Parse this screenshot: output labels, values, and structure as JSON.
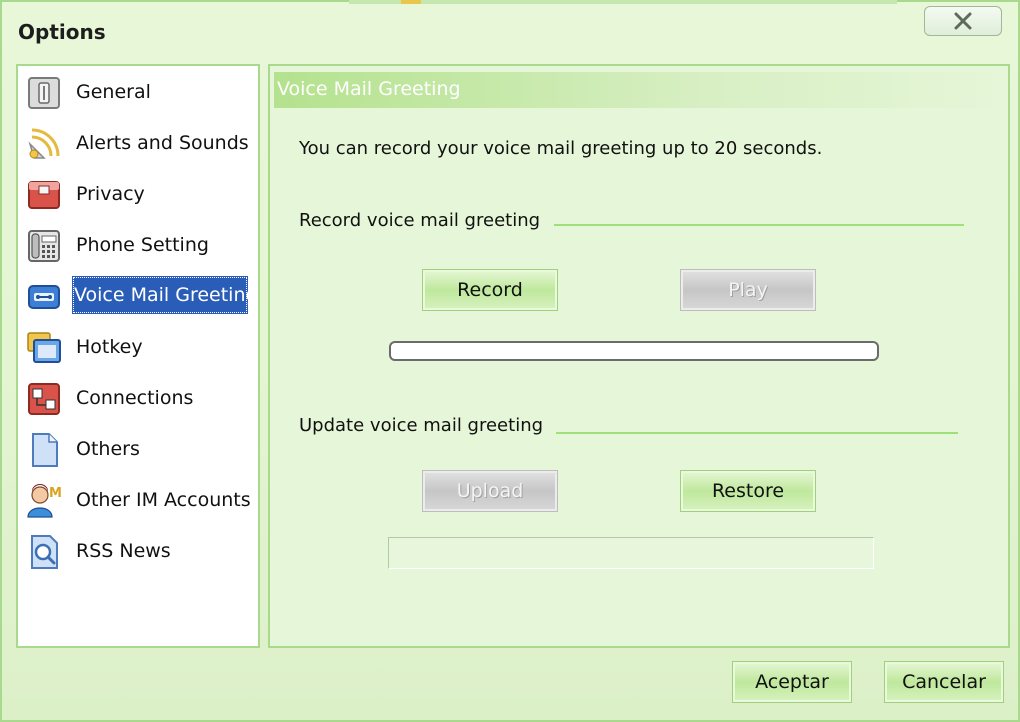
{
  "window": {
    "title": "Options",
    "close_symbol": "✕"
  },
  "sidebar": {
    "items": [
      {
        "label": "General",
        "icon": "general-icon",
        "selected": false
      },
      {
        "label": "Alerts and Sounds",
        "icon": "alerts-sounds-icon",
        "selected": false
      },
      {
        "label": "Privacy",
        "icon": "privacy-icon",
        "selected": false
      },
      {
        "label": "Phone Setting",
        "icon": "phone-icon",
        "selected": false
      },
      {
        "label": "Voice Mail Greeting",
        "icon": "voicemail-icon",
        "selected": true
      },
      {
        "label": "Hotkey",
        "icon": "hotkey-icon",
        "selected": false
      },
      {
        "label": "Connections",
        "icon": "connections-icon",
        "selected": false
      },
      {
        "label": "Others",
        "icon": "document-icon",
        "selected": false
      },
      {
        "label": "Other IM Accounts",
        "icon": "im-accounts-icon",
        "selected": false
      },
      {
        "label": "RSS News",
        "icon": "rss-news-icon",
        "selected": false
      }
    ]
  },
  "content": {
    "header": "Voice Mail Greeting",
    "description": "You can record your voice mail greeting up to 20 seconds.",
    "record_section": {
      "label": "Record voice mail greeting",
      "record_button": "Record",
      "play_button": "Play",
      "play_enabled": false,
      "progress_fraction": 0
    },
    "update_section": {
      "label": "Update voice mail greeting",
      "upload_button": "Upload",
      "upload_enabled": false,
      "restore_button": "Restore",
      "file_value": ""
    }
  },
  "footer": {
    "ok_button": "Aceptar",
    "cancel_button": "Cancelar"
  },
  "colors": {
    "window_background": "#e4f5d2",
    "border_green": "#a9d98c",
    "selection_blue": "#2a5db7",
    "button_green": "#bfe89c",
    "disabled_gray": "#c6c6c6"
  }
}
